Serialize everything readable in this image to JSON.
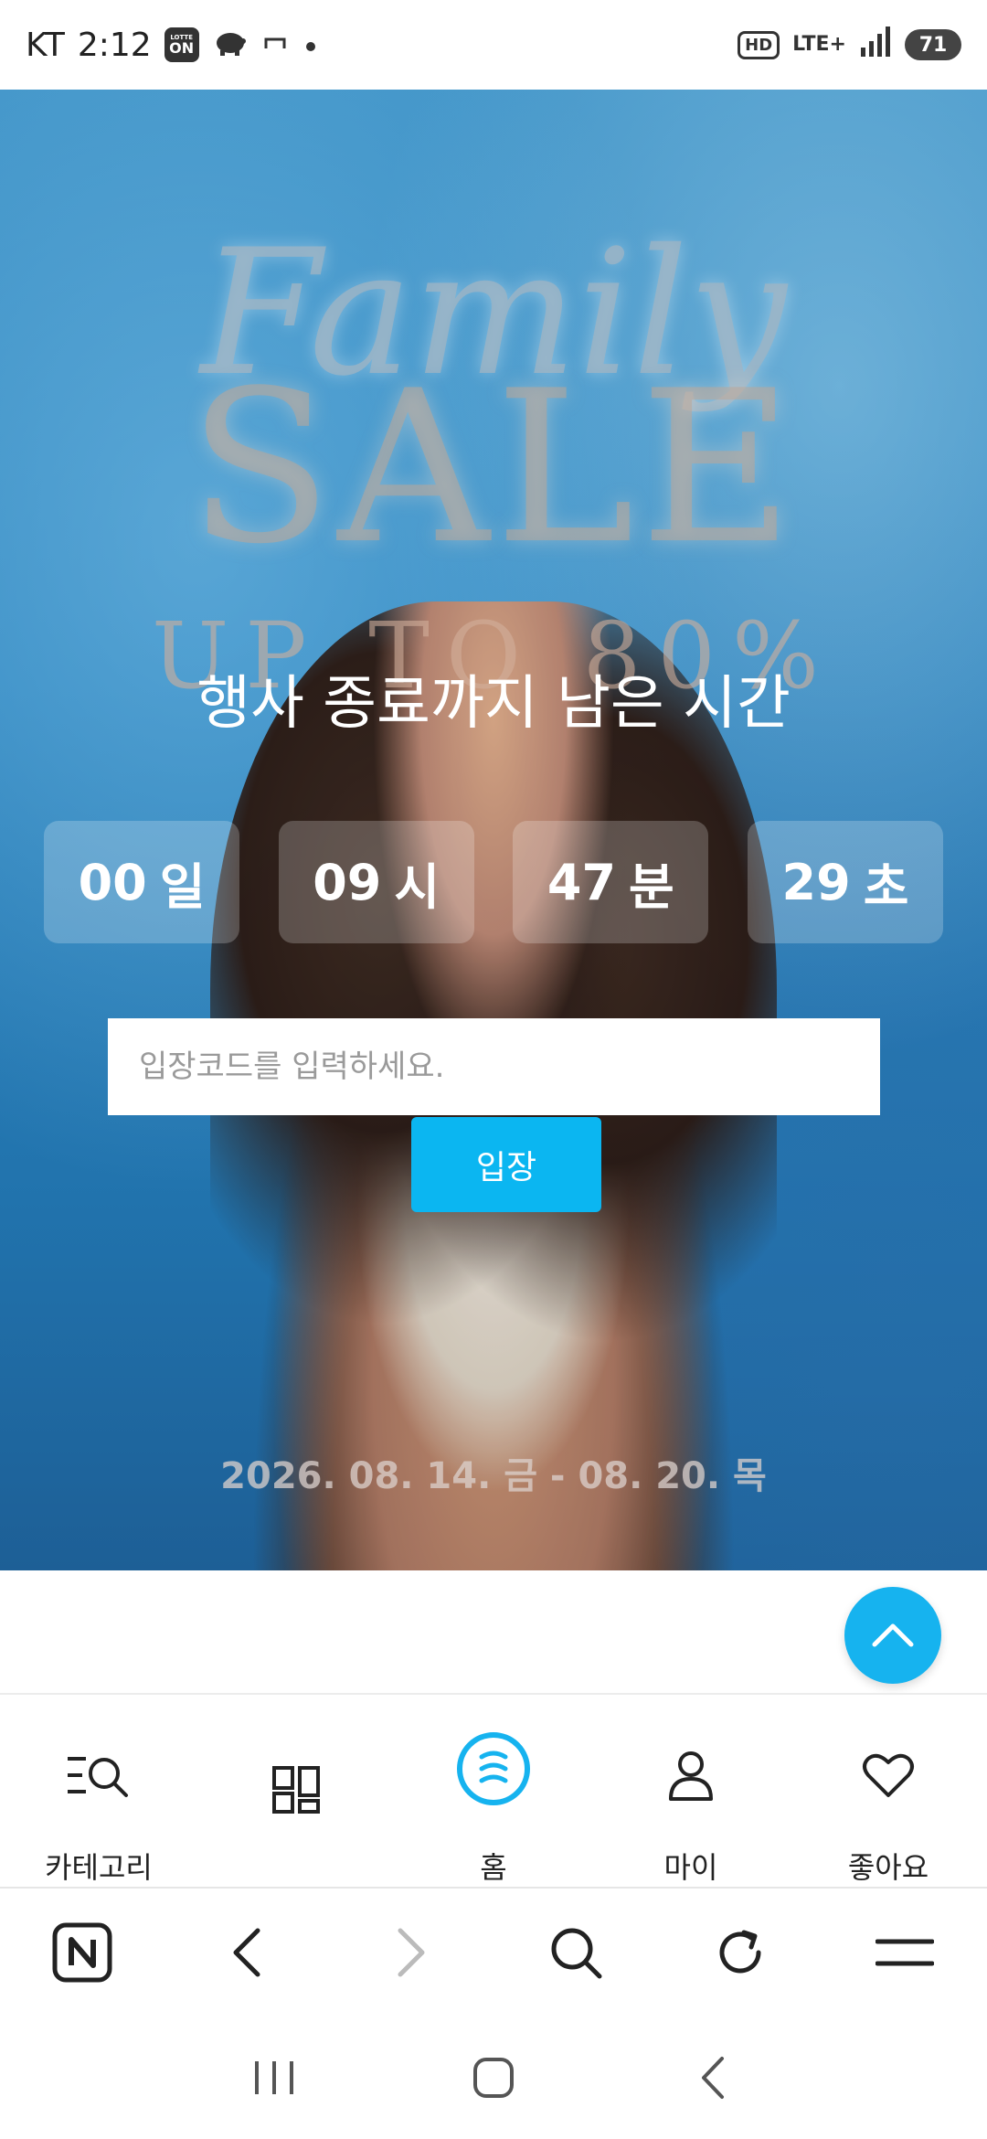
{
  "status_bar": {
    "carrier": "KT",
    "time": "2:12",
    "lotte_badge_small": "LOTTE",
    "lotte_badge_big": "ON",
    "hd_label": "HD",
    "network_label": "LTE+",
    "battery": "71"
  },
  "banner": {
    "script_title": "Family",
    "sale_title": "SALE",
    "discount": "UP TO 80%",
    "countdown_title": "행사 종료까지 남은 시간",
    "countdown": [
      {
        "value": "00",
        "unit": "일"
      },
      {
        "value": "09",
        "unit": "시"
      },
      {
        "value": "47",
        "unit": "분"
      },
      {
        "value": "29",
        "unit": "초"
      }
    ],
    "code_placeholder": "입장코드를 입력하세요.",
    "enter_label": "입장",
    "dates": "2026. 08. 14. 금 - 08. 20. 목"
  },
  "app_nav": {
    "items": [
      {
        "label": "카테고리",
        "icon": "category-search-icon"
      },
      {
        "label": "",
        "icon": "grid-icon"
      },
      {
        "label": "홈",
        "icon": "home-logo-icon",
        "active": true
      },
      {
        "label": "마이",
        "icon": "person-icon"
      },
      {
        "label": "좋아요",
        "icon": "heart-icon"
      }
    ]
  },
  "browser_bar": {
    "items": [
      "naver-n-icon",
      "back-icon",
      "forward-icon",
      "search-icon",
      "refresh-icon",
      "menu-icon"
    ]
  },
  "system_nav": {
    "items": [
      "recents-icon",
      "home-icon",
      "back-icon"
    ]
  },
  "colors": {
    "accent": "#0bb6f1",
    "scroll_top": "#16b3ef"
  }
}
